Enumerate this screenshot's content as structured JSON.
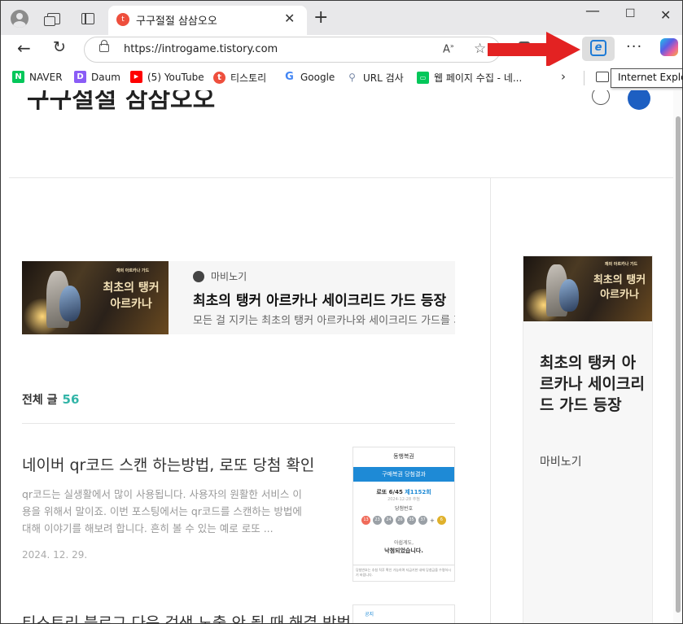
{
  "browser": {
    "tab_title": "구구절절 삼삼오오",
    "tab_favicon": "tistory-icon",
    "close_glyph": "✕",
    "newtab_glyph": "+",
    "url": "https://introgame.tistory.com",
    "read_aloud": "A)",
    "tooltip": "Internet Explorer"
  },
  "bookmarks": [
    {
      "label": "NAVER",
      "icon": "naver-icon",
      "color": "#03c75a",
      "glyph": "N"
    },
    {
      "label": "Daum",
      "icon": "daum-icon",
      "color": "#8a5cf6",
      "glyph": "D"
    },
    {
      "label": "(5) YouTube",
      "icon": "youtube-icon",
      "color": "#ff0000",
      "glyph": "▶"
    },
    {
      "label": "티스토리",
      "icon": "tistory-icon",
      "color": "#ee4f3d",
      "glyph": "t"
    },
    {
      "label": "Google",
      "icon": "google-icon",
      "color": "#4285f4",
      "glyph": "G"
    },
    {
      "label": "URL 검사",
      "icon": "url-check-icon",
      "color": "#7a8aa8",
      "glyph": "⚲"
    },
    {
      "label": "웹 페이지 수집 - 네...",
      "icon": "webpage-collect-icon",
      "color": "#03c75a",
      "glyph": "▭"
    }
  ],
  "blog": {
    "title": "구구절절 삼삼오오",
    "featured": {
      "category": "마비노기",
      "title": "최초의 탱커 아르카나 세이크리드 가드 등장",
      "description": "모든 걸 지키는 최초의 탱커 아르카나와 세이크리드 가드를 지",
      "thumb_banner": "최초의 탱커",
      "thumb_sub": "아르카나",
      "thumb_small": "재의 아르카나 가드"
    },
    "all_posts_label": "전체 글",
    "all_posts_count": "56",
    "post1": {
      "title": "네이버 qr코드 스캔 하는방법, 로또 당첨 확인",
      "excerpt": "qr코드는 실생활에서 많이 사용됩니다. 사용자의 원활한 서비스 이용을 위해서 말이죠. 이번 포스팅에서는 qr코드를 스캔하는 방법에 대해 이야기를 해보려 합니다. 흔히 볼 수 있는 예로 로또 ...",
      "date": "2024. 12. 29."
    },
    "post1_thumb": {
      "logo": "동행복권",
      "band": "구매복권 당첨결과",
      "round_prefix": "로또 6/45",
      "round": "제1152회",
      "date": "2024-12-28 추첨",
      "sub": "당첨번호",
      "balls": [
        "13",
        "23",
        "24",
        "26",
        "35",
        "37",
        "6"
      ],
      "msg1": "아쉽게도,",
      "msg2": "낙첨되었습니다.",
      "foot": "당첨번호는 추첨 직후 확인 가능하며 지급기한 내에 당첨금을 수령하시기 바랍니다."
    },
    "post2": {
      "title": "티스토리 블로그 다음 검색 노출 안 될 때 해결 방법",
      "thumb_label": "공지"
    },
    "side": {
      "title": "최초의 탱커 아르카나 세이크리드 가드 등장",
      "category": "마비노기"
    }
  },
  "colors": {
    "accent_count": "#33b5a8",
    "arrow": "#e32222"
  }
}
